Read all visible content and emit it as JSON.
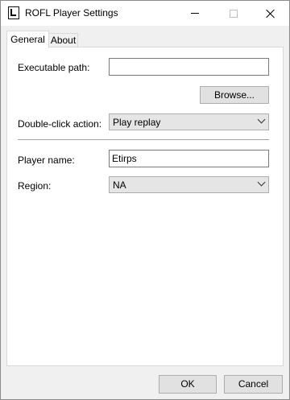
{
  "window": {
    "title": "ROFL Player Settings"
  },
  "tabs": [
    {
      "label": "General",
      "selected": true
    },
    {
      "label": "About",
      "selected": false
    }
  ],
  "general": {
    "executable_path": {
      "label": "Executable path:",
      "value": ""
    },
    "browse_label": "Browse...",
    "double_click_action": {
      "label": "Double-click action:",
      "selected": "Play replay"
    },
    "player_name": {
      "label": "Player name:",
      "value": "Etirps"
    },
    "region": {
      "label": "Region:",
      "selected": "NA"
    }
  },
  "footer": {
    "ok_label": "OK",
    "cancel_label": "Cancel"
  }
}
